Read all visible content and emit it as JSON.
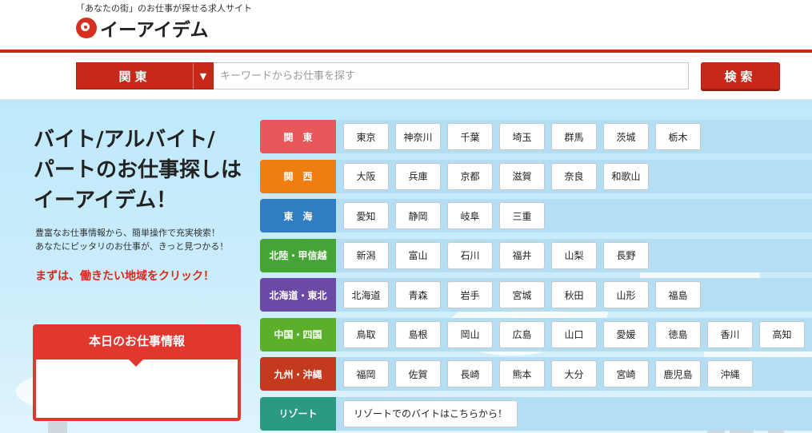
{
  "header": {
    "tagline": "「あなたの街」のお仕事が探せる求人サイト",
    "logo_text": "イーアイデム"
  },
  "search": {
    "region": "関東",
    "arrow": "▼",
    "placeholder": "キーワードからお仕事を探す",
    "button": "検索",
    "accent": "#c8281a"
  },
  "hero": {
    "line1": "バイト/アルバイト/",
    "line2": "パートのお仕事探しは",
    "line3": "イーアイデム！",
    "desc1": "豊富なお仕事情報から、簡単操作で充実検索！",
    "desc2": "あなたにピッタリのお仕事が、きっと見つかる！",
    "cta": "まずは、働きたい地域をクリック！"
  },
  "today": {
    "title": "本日のお仕事情報"
  },
  "regions": [
    {
      "label": "関　東",
      "color": "#e8585a",
      "prefs": [
        "東京",
        "神奈川",
        "千葉",
        "埼玉",
        "群馬",
        "茨城",
        "栃木"
      ]
    },
    {
      "label": "関　西",
      "color": "#ef7e12",
      "prefs": [
        "大阪",
        "兵庫",
        "京都",
        "滋賀",
        "奈良",
        "和歌山"
      ]
    },
    {
      "label": "東　海",
      "color": "#2f7ec4",
      "prefs": [
        "愛知",
        "静岡",
        "岐阜",
        "三重"
      ]
    },
    {
      "label": "北陸・甲信越",
      "color": "#46a436",
      "prefs": [
        "新潟",
        "富山",
        "石川",
        "福井",
        "山梨",
        "長野"
      ]
    },
    {
      "label": "北海道・東北",
      "color": "#6b4aa6",
      "prefs": [
        "北海道",
        "青森",
        "岩手",
        "宮城",
        "秋田",
        "山形",
        "福島"
      ]
    },
    {
      "label": "中国・四国",
      "color": "#5ab02a",
      "prefs": [
        "鳥取",
        "島根",
        "岡山",
        "広島",
        "山口",
        "愛媛",
        "徳島",
        "香川",
        "高知"
      ]
    },
    {
      "label": "九州・沖縄",
      "color": "#c43a1e",
      "prefs": [
        "福岡",
        "佐賀",
        "長崎",
        "熊本",
        "大分",
        "宮崎",
        "鹿児島",
        "沖縄"
      ]
    },
    {
      "label": "リゾート",
      "color": "#2a9a82",
      "resort": "リゾートでのバイトはこちらから！"
    }
  ]
}
